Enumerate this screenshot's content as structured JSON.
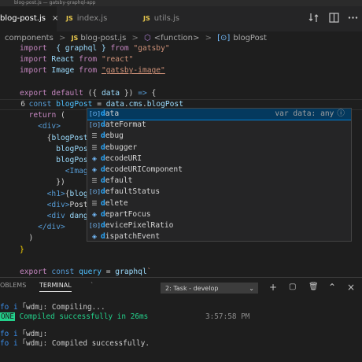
{
  "window": {
    "title": "blog-post.js — gatsby-graphql-app"
  },
  "tabs": [
    {
      "badge": "JS",
      "label": "blog-post.js",
      "close": "×",
      "active": true
    },
    {
      "badge": "JS",
      "label": "index.js",
      "active": false
    },
    {
      "badge": "JS",
      "label": "utils.js",
      "active": false
    }
  ],
  "toolbar_icons": [
    "compare-icon",
    "split-editor-icon",
    "more-icon"
  ],
  "breadcrumbs": [
    "components",
    ">",
    "blog-post.js",
    ">",
    "<function>",
    ">",
    "blogPost"
  ],
  "editor": {
    "gutter": [
      "",
      "",
      "",
      "",
      "",
      "6",
      "",
      "",
      "",
      "",
      "",
      "",
      "",
      "",
      "",
      "",
      "",
      "",
      "",
      "",
      ""
    ],
    "lines": [
      [
        [
          "kw",
          "import"
        ],
        [
          "",
          "  "
        ],
        [
          "var",
          "{ graphql }"
        ],
        [
          "",
          ""
        ],
        [
          "kw",
          " from "
        ],
        [
          "str",
          "\"gatsby\""
        ]
      ],
      [
        [
          "kw",
          "import"
        ],
        [
          "",
          ""
        ],
        [
          "var",
          " React"
        ],
        [
          "kw",
          " from "
        ],
        [
          "str",
          "\"react\""
        ]
      ],
      [
        [
          "kw",
          "import"
        ],
        [
          "",
          ""
        ],
        [
          "var",
          " Image"
        ],
        [
          "kw",
          " from "
        ],
        [
          "str u",
          "\"gatsby-image\""
        ]
      ],
      [
        [
          "",
          ""
        ]
      ],
      [
        [
          "kw",
          "export default"
        ],
        [
          "",
          " ({ "
        ],
        [
          "var",
          "data"
        ],
        [
          "",
          " }) "
        ],
        [
          "kb",
          "=>"
        ],
        [
          "",
          " {"
        ]
      ],
      [
        [
          "",
          "  "
        ],
        [
          "kb",
          "const"
        ],
        [
          "cst",
          " blogPost"
        ],
        [
          "",
          " = "
        ],
        [
          "var",
          "data"
        ],
        [
          "",
          "."
        ],
        [
          "var",
          "cms"
        ],
        [
          "",
          "."
        ],
        [
          "var",
          "blogPost"
        ]
      ],
      [
        [
          "",
          "  "
        ],
        [
          "kw",
          "return"
        ],
        [
          "",
          " ("
        ]
      ],
      [
        [
          "",
          "    "
        ],
        [
          "tag",
          "<div>"
        ]
      ],
      [
        [
          "",
          "      {"
        ],
        [
          "var",
          "blogPost"
        ]
      ],
      [
        [
          "",
          "        "
        ],
        [
          "var",
          "blogPost"
        ]
      ],
      [
        [
          "",
          "        "
        ],
        [
          "var",
          "blogPost"
        ]
      ],
      [
        [
          "",
          "          "
        ],
        [
          "tag",
          "<Image"
        ]
      ],
      [
        [
          "",
          "        })"
        ]
      ],
      [
        [
          "",
          "      "
        ],
        [
          "tag",
          "<h1>"
        ],
        [
          "",
          "{"
        ],
        [
          "var",
          "blog"
        ]
      ],
      [
        [
          "",
          "      "
        ],
        [
          "tag",
          "<div>"
        ],
        [
          "",
          "Post"
        ]
      ],
      [
        [
          "",
          "      "
        ],
        [
          "tag",
          "<div"
        ],
        [
          "var",
          " dang"
        ]
      ],
      [
        [
          "",
          "    "
        ],
        [
          "tag",
          "</div>"
        ]
      ],
      [
        [
          "",
          "  )"
        ]
      ],
      [
        [
          "brk",
          "}"
        ]
      ],
      [
        [
          "",
          ""
        ]
      ],
      [
        [
          "kw",
          "export"
        ],
        [
          "kb",
          " const"
        ],
        [
          "cst",
          " query"
        ],
        [
          "",
          " = "
        ],
        [
          "var",
          "graphql"
        ],
        [
          "str",
          "`"
        ]
      ]
    ]
  },
  "suggestions": {
    "detail": "var data: any",
    "info_icon": "ⓘ",
    "items": [
      {
        "icon": "[⊙]",
        "kind": "prop",
        "match": "d",
        "rest": "ata",
        "selected": true
      },
      {
        "icon": "[⊙]",
        "kind": "prop",
        "match": "d",
        "rest": "ateFormat"
      },
      {
        "icon": "☰",
        "kind": "kwd",
        "match": "d",
        "rest": "ebug"
      },
      {
        "icon": "☰",
        "kind": "kwd",
        "match": "d",
        "rest": "ebugger"
      },
      {
        "icon": "◈",
        "kind": "prop",
        "match": "d",
        "rest": "ecodeURI"
      },
      {
        "icon": "◈",
        "kind": "prop",
        "match": "d",
        "rest": "ecodeURIComponent"
      },
      {
        "icon": "☰",
        "kind": "kwd",
        "match": "d",
        "rest": "efault"
      },
      {
        "icon": "[⊙]",
        "kind": "prop",
        "match": "d",
        "rest": "efaultStatus"
      },
      {
        "icon": "☰",
        "kind": "kwd",
        "match": "d",
        "rest": "elete"
      },
      {
        "icon": "◈",
        "kind": "prop",
        "match": "d",
        "rest": "epartFocus"
      },
      {
        "icon": "[⊙]",
        "kind": "prop",
        "match": "d",
        "rest": "evicePixelRatio"
      },
      {
        "icon": "◈",
        "kind": "prop",
        "match": "d",
        "rest": "ispatchEvent"
      }
    ]
  },
  "panel": {
    "tabs": [
      "OBLEMS",
      "TERMINAL",
      "`"
    ],
    "task_select": "2: Task - develop",
    "task_arrow": "⌄",
    "icons": [
      "+",
      "▢",
      "🗑",
      "⌃",
      "×"
    ],
    "terminal": [
      {
        "prefix": "fo",
        "sep": "i",
        "text": "｢wdm｣: Compiling..."
      },
      {
        "prefix": "ONE",
        "text": "Compiled successfully in 26ms",
        "time": "3:57:58 PM"
      },
      {
        "prefix": "",
        "text": ""
      },
      {
        "prefix": "fo",
        "sep": "i",
        "text": "｢wdm｣:"
      },
      {
        "prefix": "fo",
        "sep": "i",
        "text": "｢wdm｣: Compiled successfully."
      }
    ]
  }
}
